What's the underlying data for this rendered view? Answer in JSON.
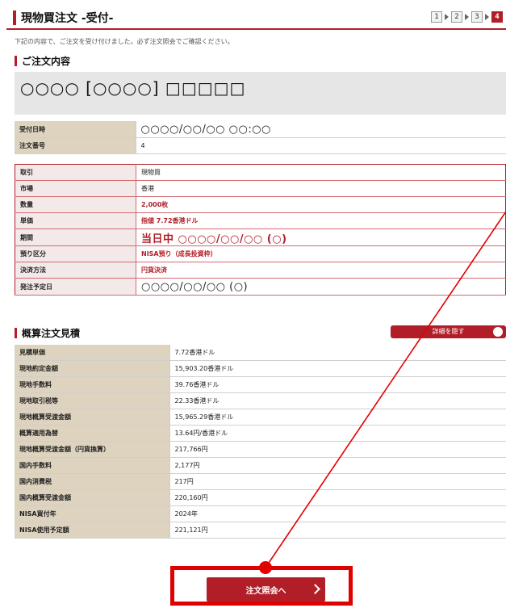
{
  "header": {
    "title": "現物買注文 -受付-",
    "steps": [
      "1",
      "2",
      "3",
      "4"
    ]
  },
  "notice": "下記の内容で、ご注文を受け付けました。必ず注文照会でご確認ください。",
  "order_section": {
    "title": "ご注文内容",
    "instrument_title": "○○○○ [○○○○] □□□□□",
    "top_rows": [
      {
        "label": "受付日時",
        "value": "○○○○/○○/○○ ○○:○○"
      },
      {
        "label": "注文番号",
        "value": "4"
      }
    ],
    "detail_rows": [
      {
        "label": "取引",
        "value": "現物買"
      },
      {
        "label": "市場",
        "value": "香港"
      },
      {
        "label": "数量",
        "value": "2,000枚"
      },
      {
        "label": "単価",
        "value": "指値 7.72香港ドル"
      },
      {
        "label": "期間",
        "value": "当日中 ○○○○/○○/○○ (○)"
      },
      {
        "label": "預り区分",
        "value": "NISA預り（成長投資枠）"
      },
      {
        "label": "決済方法",
        "value": "円貨決済"
      },
      {
        "label": "発注予定日",
        "value": "○○○○/○○/○○ (○)"
      }
    ]
  },
  "estimate_section": {
    "title": "概算注文見積",
    "detail_button": "詳細を隠す",
    "rows": [
      {
        "label": "見積単価",
        "value": "7.72香港ドル"
      },
      {
        "label": "現地約定金額",
        "value": "15,903.20香港ドル"
      },
      {
        "label": "現地手数料",
        "value": "39.76香港ドル"
      },
      {
        "label": "現地取引税等",
        "value": "22.33香港ドル"
      },
      {
        "label": "現地概算受渡金額",
        "value": "15,965.29香港ドル"
      },
      {
        "label": "概算適用為替",
        "value": "13.64円/香港ドル"
      },
      {
        "label": "現地概算受渡金額（円貨換算）",
        "value": "217,766円"
      },
      {
        "label": "国内手数料",
        "value": "2,177円"
      },
      {
        "label": "国内消費税",
        "value": "217円"
      },
      {
        "label": "国内概算受渡金額",
        "value": "220,160円"
      },
      {
        "label": "NISA買付年",
        "value": "2024年"
      },
      {
        "label": "NISA使用予定額",
        "value": "221,121円"
      }
    ]
  },
  "footer": {
    "button_label": "注文照会へ"
  },
  "colors": {
    "accent": "#b21e28",
    "annotation": "#e00000"
  }
}
